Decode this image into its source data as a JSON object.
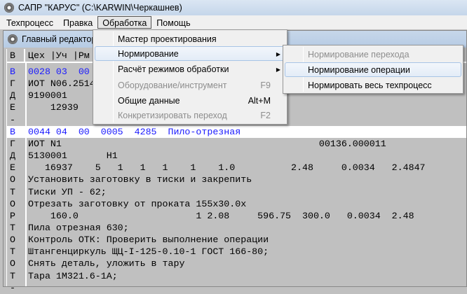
{
  "window": {
    "title": "САПР \"КАРУС\" (C:\\KARWIN\\Черкашнев)"
  },
  "menubar": [
    "Техпроцесс",
    "Правка",
    "Обработка",
    "Помощь"
  ],
  "inner_window": {
    "title": "Главный редактор т"
  },
  "editor": {
    "header": {
      "col1": "В",
      "col2": "Цех  |Уч  |Рм"
    },
    "rows": [
      {
        "code": "В",
        "text": "0028 03  00",
        "blue": true
      },
      {
        "code": "Г",
        "text": "ИОТ N06.2514"
      },
      {
        "code": "Д",
        "text": "9190001"
      },
      {
        "code": "Е",
        "text": "    12939"
      },
      {
        "code": "-",
        "text": ""
      },
      {
        "code": "В",
        "text": "0044 04  00  0005  4285  Пило-отрезная",
        "blue": true,
        "selected": true
      },
      {
        "code": "Г",
        "text": "ИОТ N1                                              00136.000011"
      },
      {
        "code": "Д",
        "text": "5130001       Н1"
      },
      {
        "code": "Е",
        "text": "   16937    5   1   1   1    1    1.0          2.48     0.0034   2.4847"
      },
      {
        "code": "О",
        "text": "Установить заготовку в тиски и закрепить"
      },
      {
        "code": "Т",
        "text": "Тиски УП - 62;"
      },
      {
        "code": "О",
        "text": "Отрезать заготовку от проката 155х30.0х"
      },
      {
        "code": "Р",
        "text": "    160.0                     1 2.08     596.75  300.0   0.0034  2.48"
      },
      {
        "code": "Т",
        "text": "Пила отрезная 630;"
      },
      {
        "code": "О",
        "text": "Контроль ОТК: Проверить выполнение операции"
      },
      {
        "code": "Т",
        "text": "Штангенциркуль ЩЦ-I-125-0.10-1 ГОСТ 166-80;"
      },
      {
        "code": "О",
        "text": "Снять деталь, уложить в тару"
      },
      {
        "code": "Т",
        "text": "Тара 1М321.6-1А;"
      },
      {
        "code": "-",
        "text": ""
      }
    ]
  },
  "dropdown": [
    {
      "label": "Мастер проектирования"
    },
    {
      "label": "Нормирование",
      "submenu": true,
      "highlighted": true
    },
    {
      "label": "Расчёт режимов обработки",
      "submenu": true
    },
    {
      "label": "Оборудование/инструмент",
      "shortcut": "F9",
      "disabled": true
    },
    {
      "label": "Общие данные",
      "shortcut": "Alt+M"
    },
    {
      "label": "Конкретизировать переход",
      "shortcut": "F2",
      "disabled": true
    }
  ],
  "submenu": [
    {
      "label": "Нормирование перехода",
      "disabled": true
    },
    {
      "label": "Нормирование операции",
      "highlighted": true
    },
    {
      "label": "Нормировать весь техпроцесс"
    }
  ]
}
